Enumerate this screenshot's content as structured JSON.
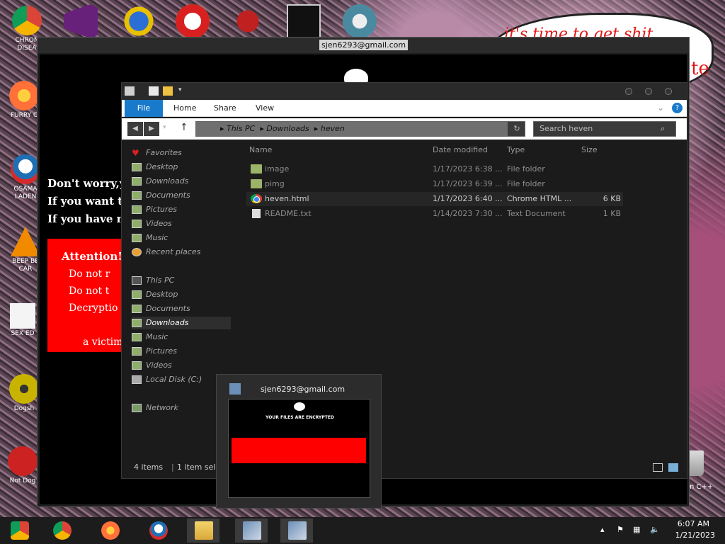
{
  "desktop": {
    "icons": [
      {
        "label": "CHRON\nDISEA",
        "color": "#4285f4"
      },
      {
        "label": "FURRY C",
        "color": "#ff7139"
      },
      {
        "label": "OSAMA\nLADEN",
        "color": "#1f6fb5"
      },
      {
        "label": "BEEP BE\nCAR",
        "color": "#f28a00"
      },
      {
        "label": "SEX ED",
        "color": "#1a9e4a"
      },
      {
        "label": "Dogsh",
        "color": "#c8b400"
      },
      {
        "label": "Not Dog",
        "color": "#cc2222"
      }
    ],
    "wallpaper_text": "it's time to get shit",
    "wallpaper_text2": "te",
    "corner_label": "n C++"
  },
  "ransom": {
    "title": "sjen6293@gmail.com",
    "lines": [
      "Don't worry,yo",
      "If you want to",
      "If you have no"
    ],
    "attention_title": "Attention!",
    "attention_items": [
      "Do not r",
      "Do not t",
      "Decryptio"
    ],
    "attention_extra": "a victim"
  },
  "explorer": {
    "tabs": {
      "file": "File",
      "home": "Home",
      "share": "Share",
      "view": "View"
    },
    "path": [
      "This PC",
      "Downloads",
      "heven"
    ],
    "search_placeholder": "Search heven",
    "nav": {
      "favorites": "Favorites",
      "fav_items": [
        "Desktop",
        "Downloads",
        "Documents",
        "Pictures",
        "Videos",
        "Music",
        "Recent places"
      ],
      "this_pc": "This PC",
      "pc_items": [
        "Desktop",
        "Documents",
        "Downloads",
        "Music",
        "Pictures",
        "Videos",
        "Local Disk (C:)"
      ],
      "network": "Network"
    },
    "columns": {
      "name": "Name",
      "date": "Date modified",
      "type": "Type",
      "size": "Size"
    },
    "files": [
      {
        "name": "image",
        "date": "1/17/2023 6:38 ...",
        "type": "File folder",
        "size": "",
        "icon": "folder-icon"
      },
      {
        "name": "pimg",
        "date": "1/17/2023 6:39 ...",
        "type": "File folder",
        "size": "",
        "icon": "folder-icon"
      },
      {
        "name": "heven.html",
        "date": "1/17/2023 6:40 ...",
        "type": "Chrome HTML ...",
        "size": "6 KB",
        "icon": "chrome-icon"
      },
      {
        "name": "README.txt",
        "date": "1/14/2023 7:30 ...",
        "type": "Text Document",
        "size": "1 KB",
        "icon": "text-file-icon"
      }
    ],
    "status_items": "4 items",
    "status_selected": "1 item sel"
  },
  "thumbnail": {
    "title": "sjen6293@gmail.com",
    "heading": "YOUR FILES ARE ENCRYPTED"
  },
  "taskbar": {
    "time": "6:07 AM",
    "date": "1/21/2023"
  }
}
